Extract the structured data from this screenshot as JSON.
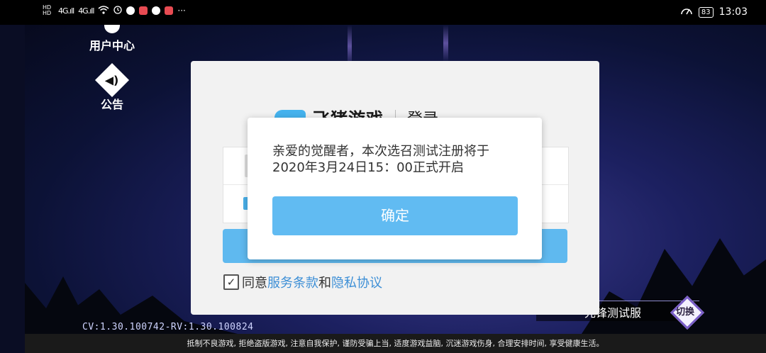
{
  "status_bar": {
    "network_hd_1": "HD",
    "network_hd_2": "HD",
    "signal_1": "4G.ıll",
    "signal_2": "4G.ıll",
    "battery": "83",
    "time": "13:03",
    "more": "···"
  },
  "game": {
    "user_center_label": "用户中心",
    "announcement_label": "公告",
    "version": "CV:1.30.100742-RV:1.30.100824",
    "server_name": "先锋测试服",
    "switch_label": "切换",
    "footer_notice": "抵制不良游戏, 拒绝盗版游戏, 注意自我保护, 谨防受骗上当, 适度游戏益脑, 沉迷游戏伤身, 合理安排时间, 享受健康生活。"
  },
  "login": {
    "brand_name": "飞猪游戏",
    "title": "登录",
    "agree_prefix": "同意",
    "terms_link": "服务条款",
    "and": "和",
    "privacy_link": "隐私协议",
    "checkbox_mark": "✓"
  },
  "modal": {
    "message": "亲爱的觉醒者，本次选召测试注册将于\n2020年3月24日15：00正式开启",
    "confirm": "确定"
  }
}
